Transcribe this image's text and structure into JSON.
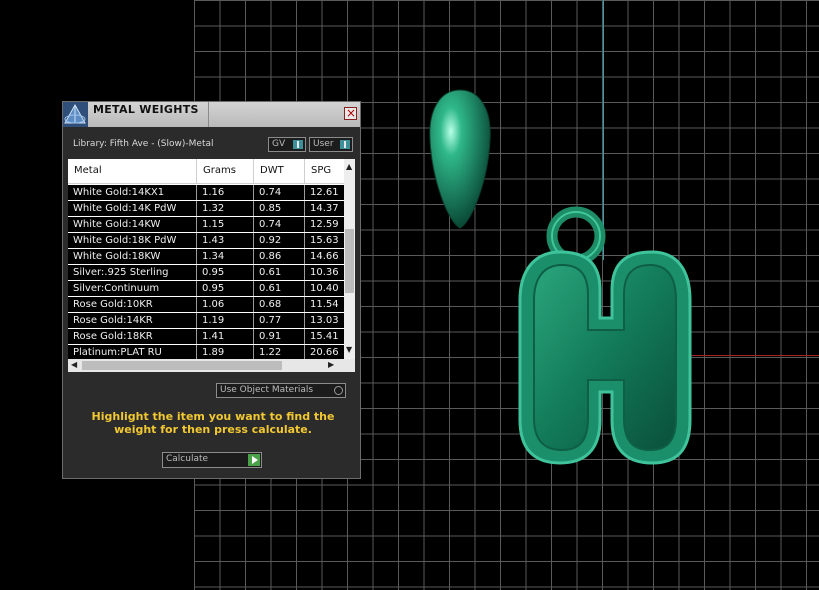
{
  "dialog": {
    "title": "METAL WEIGHTS",
    "close_glyph": "×",
    "library_label": "Library: Fifth Ave - (Slow)-Metal",
    "toggles": {
      "gv": "GV",
      "user": "User"
    },
    "use_object_label": "Use Object Materials",
    "hint": "Highlight the item you want to find the weight for then press calculate.",
    "calculate_label": "Calculate"
  },
  "table": {
    "headers": {
      "metal": "Metal",
      "grams": "Grams",
      "dwt": "DWT",
      "spg": "SPG"
    },
    "rows": [
      {
        "metal": "White Gold:14KX1",
        "grams": "1.16",
        "dwt": "0.74",
        "spg": "12.61"
      },
      {
        "metal": "White Gold:14K PdW",
        "grams": "1.32",
        "dwt": "0.85",
        "spg": "14.37"
      },
      {
        "metal": "White Gold:14KW",
        "grams": "1.15",
        "dwt": "0.74",
        "spg": "12.59"
      },
      {
        "metal": "White Gold:18K PdW",
        "grams": "1.43",
        "dwt": "0.92",
        "spg": "15.63"
      },
      {
        "metal": "White Gold:18KW",
        "grams": "1.34",
        "dwt": "0.86",
        "spg": "14.66"
      },
      {
        "metal": "Silver:.925 Sterling",
        "grams": "0.95",
        "dwt": "0.61",
        "spg": "10.36"
      },
      {
        "metal": "Silver:Continuum",
        "grams": "0.95",
        "dwt": "0.61",
        "spg": "10.40"
      },
      {
        "metal": "Rose Gold:10KR",
        "grams": "1.06",
        "dwt": "0.68",
        "spg": "11.54"
      },
      {
        "metal": "Rose Gold:14KR",
        "grams": "1.19",
        "dwt": "0.77",
        "spg": "13.03"
      },
      {
        "metal": "Rose Gold:18KR",
        "grams": "1.41",
        "dwt": "0.91",
        "spg": "15.41"
      },
      {
        "metal": "Platinum:PLAT RU",
        "grams": "1.89",
        "dwt": "1.22",
        "spg": "20.66"
      }
    ]
  },
  "colors": {
    "model_green": "#1e8f6a",
    "model_outline": "#3fc39a",
    "hint_yellow": "#f2c832",
    "axis_vertical": "#3aa0a6",
    "axis_horizontal": "#a52020"
  },
  "icons": {
    "logo": "pyramid-logo-icon",
    "close": "close-icon",
    "calculate": "play-icon"
  }
}
